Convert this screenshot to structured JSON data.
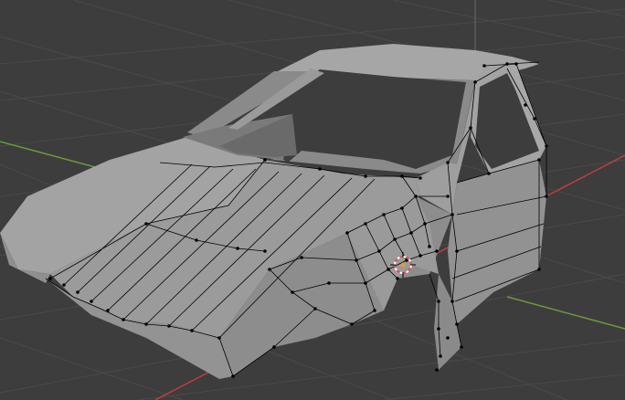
{
  "app": "Blender",
  "viewport": {
    "mode": "edit-mode",
    "object": "car-body-mesh",
    "background_color": "#3d3d3d",
    "grid_color": "#4a4a4a",
    "x_axis_color": "#b8423f",
    "y_axis_color": "#6a9a3a",
    "z_axis_color": "#6b6b6b",
    "mesh_face_color": "#9b9b9b",
    "mesh_edge_color": "#000000",
    "vertex_color": "#000000",
    "cursor_colors": [
      "#d9534f",
      "#ffffff"
    ],
    "origin_color": "#e0a030"
  }
}
